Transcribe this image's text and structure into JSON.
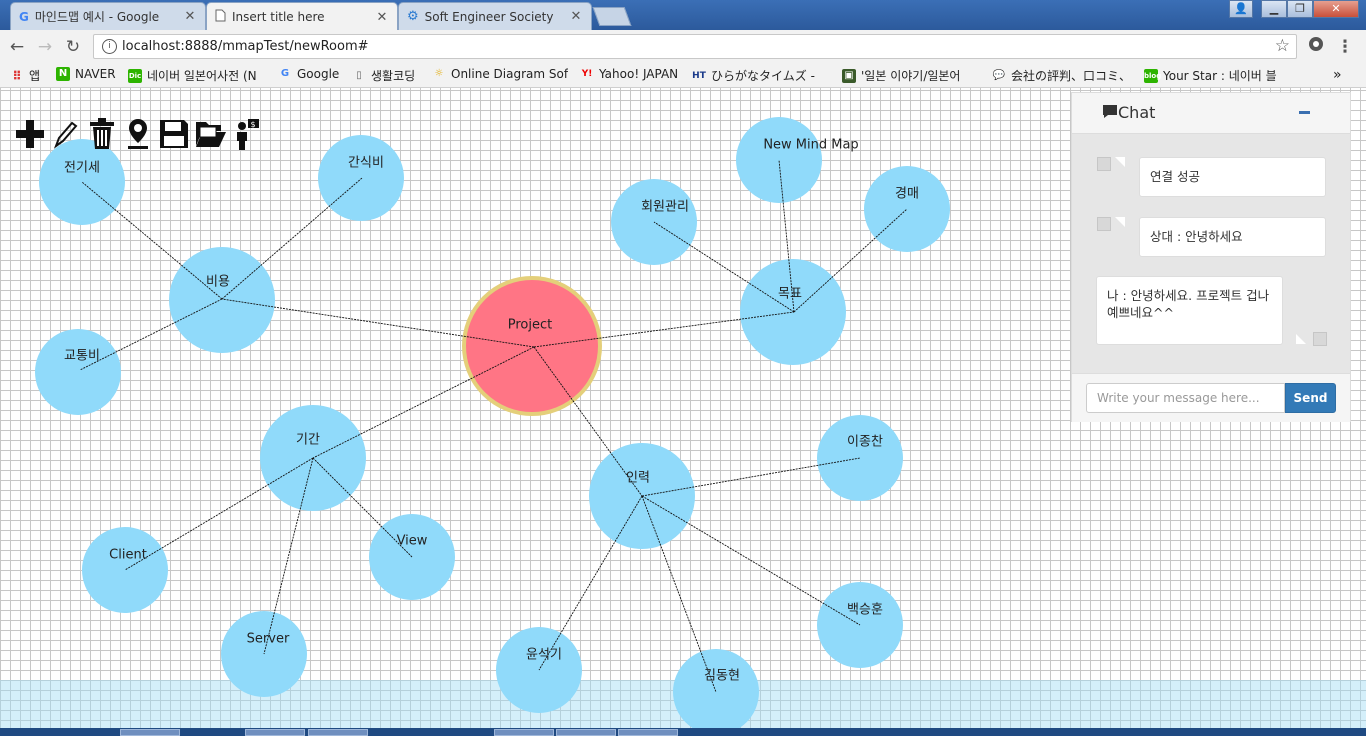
{
  "browser": {
    "tabs": [
      {
        "title": "마인드맵 예시 - Google",
        "icon": "google-icon",
        "active": false
      },
      {
        "title": "Insert title here",
        "icon": "page-icon",
        "active": true
      },
      {
        "title": "Soft Engineer Society",
        "icon": "sitemap-icon",
        "active": false
      }
    ],
    "url": "localhost:8888/mmapTest/newRoom#",
    "bookmarks": [
      {
        "label": "앱",
        "icon": "apps-icon",
        "color": "#e44"
      },
      {
        "label": "NAVER",
        "icon": "naver-icon",
        "color": "#2db400"
      },
      {
        "label": "네이버 일본어사전 (N",
        "icon": "dict-icon",
        "color": "#2db400"
      },
      {
        "label": "Google",
        "icon": "google-icon",
        "color": "#4285f4"
      },
      {
        "label": "생활코딩",
        "icon": "page-icon",
        "color": "#888"
      },
      {
        "label": "Online Diagram Softv",
        "icon": "bulb-icon",
        "color": "#f0b400"
      },
      {
        "label": "Yahoo! JAPAN",
        "icon": "yahoo-icon",
        "color": "#e00"
      },
      {
        "label": "ひらがなタイムズ - ",
        "icon": "ht-icon",
        "color": "#1a3a8a"
      },
      {
        "label": "'일본 이야기/일본어 ",
        "icon": "blog-icon",
        "color": "#3a5a2a"
      },
      {
        "label": "会社の評判、口コミ、",
        "icon": "chat-bubbles-icon",
        "color": "#1a5ab0"
      },
      {
        "label": "Your Star : 네이버 블",
        "icon": "blog-icon",
        "color": "#2db400"
      }
    ],
    "more": "»"
  },
  "mindmap": {
    "center": {
      "label": "Project"
    },
    "nodes": [
      {
        "id": "cost",
        "label": "비용"
      },
      {
        "id": "electric",
        "label": "전기세"
      },
      {
        "id": "snack",
        "label": "간식비"
      },
      {
        "id": "transport",
        "label": "교통비"
      },
      {
        "id": "period",
        "label": "기간"
      },
      {
        "id": "client",
        "label": "Client"
      },
      {
        "id": "server",
        "label": "Server"
      },
      {
        "id": "view",
        "label": "View"
      },
      {
        "id": "goal",
        "label": "목표"
      },
      {
        "id": "member",
        "label": "회원관리"
      },
      {
        "id": "newmap",
        "label": "New Mind Map"
      },
      {
        "id": "auction",
        "label": "경매"
      },
      {
        "id": "people",
        "label": "인력"
      },
      {
        "id": "lee",
        "label": "이종찬"
      },
      {
        "id": "baek",
        "label": "백승훈"
      },
      {
        "id": "kim",
        "label": "김동현"
      },
      {
        "id": "yoon",
        "label": "윤석기"
      }
    ],
    "tools": [
      "add-icon",
      "pencil-icon",
      "trash-icon",
      "location-icon",
      "save-icon",
      "folder-open-icon",
      "person-money-icon"
    ]
  },
  "chat": {
    "title": "Chat",
    "messages": [
      {
        "side": "other",
        "text": "연결 성공"
      },
      {
        "side": "other",
        "text": "상대 : 안녕하세요"
      },
      {
        "side": "me",
        "text": "나 : 안녕하세요. 프로젝트 겁나 예쁘네요^^"
      }
    ],
    "input_placeholder": "Write your message here...",
    "send_label": "Send"
  }
}
